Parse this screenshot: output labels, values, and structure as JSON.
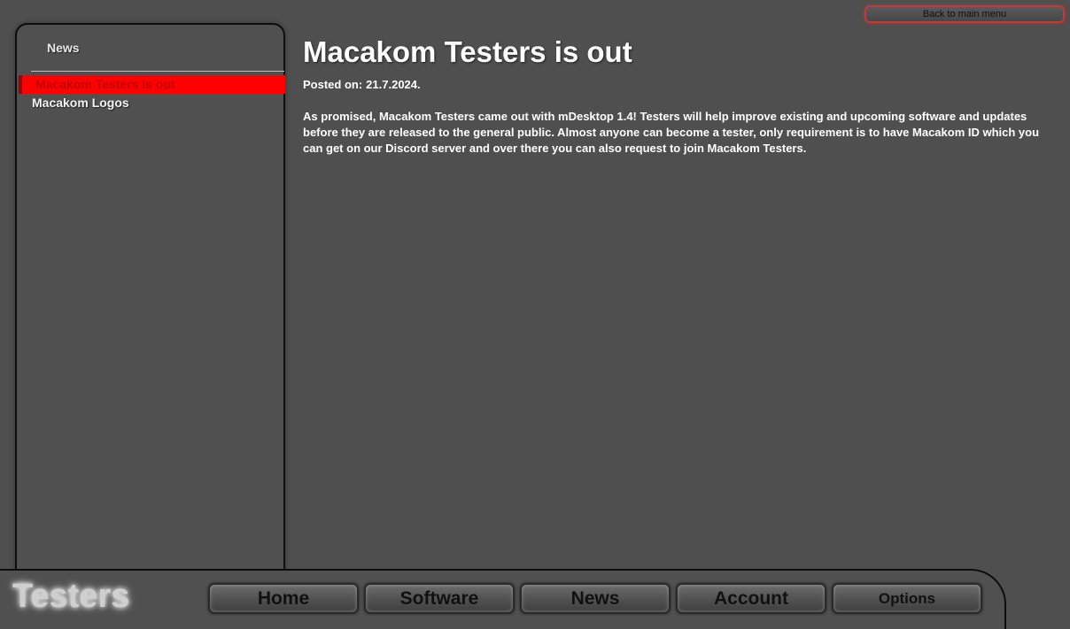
{
  "header": {
    "back_label": "Back to main menu"
  },
  "sidebar": {
    "title": "News",
    "items": [
      {
        "label": "Macakom Testers is out",
        "active": true
      },
      {
        "label": "Macakom Logos",
        "active": false
      }
    ]
  },
  "article": {
    "title": "Macakom Testers is out",
    "date_prefix": "Posted on:",
    "date": "21.7.2024.",
    "body": "As promised, Macakom Testers came out with mDesktop 1.4! Testers will help improve existing and upcoming software and updates before they are released to the general public. Almost anyone can become a tester, only requirement is to have Macakom ID which you can get on our Discord server and over there you can also request to join Macakom Testers."
  },
  "bottom_bar": {
    "brand": "Testers",
    "nav": [
      {
        "label": "Home"
      },
      {
        "label": "Software"
      },
      {
        "label": "News"
      },
      {
        "label": "Account"
      },
      {
        "label": "Options"
      }
    ]
  },
  "colors": {
    "background": "#4f4f4f",
    "active_item": "#ff0000",
    "back_button_border": "#c0393b"
  }
}
